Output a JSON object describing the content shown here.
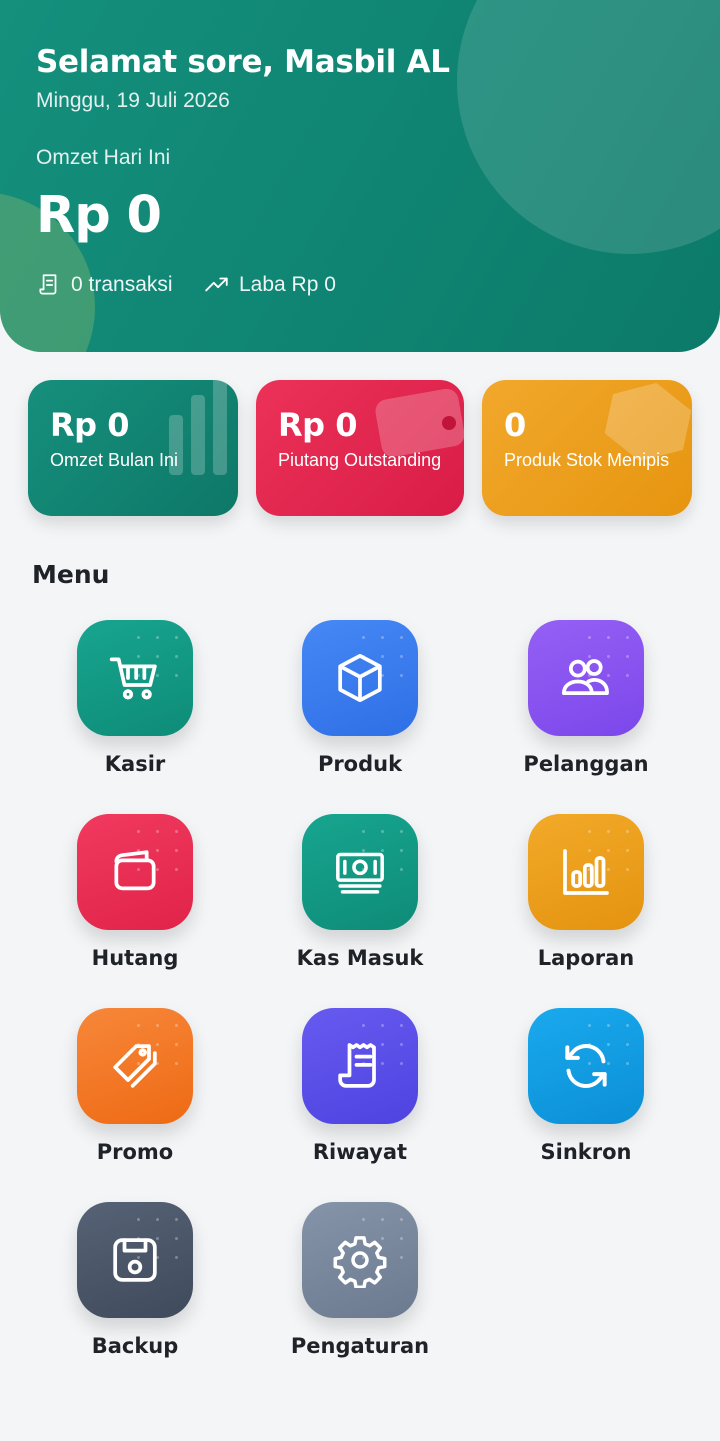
{
  "header": {
    "greeting": "Selamat sore, Masbil AL",
    "date": "Minggu, 19 Juli 2026",
    "omzet_label": "Omzet Hari Ini",
    "omzet_value": "Rp 0",
    "transactions": "0 transaksi",
    "profit": "Laba Rp 0",
    "transactions_icon": "receipt-icon",
    "profit_icon": "trending-up-icon"
  },
  "stats": [
    {
      "value": "Rp 0",
      "label": "Omzet Bulan Ini",
      "color": "#118a77",
      "icon": "bar-chart-icon"
    },
    {
      "value": "Rp 0",
      "label": "Piutang Outstanding",
      "color": "#e5284f",
      "icon": "wallet-icon"
    },
    {
      "value": "0",
      "label": "Produk Stok Menipis",
      "color": "#f0a020",
      "icon": "box-icon"
    }
  ],
  "menu": {
    "title": "Menu",
    "items": [
      {
        "label": "Kasir",
        "icon": "cart-icon",
        "color": "#14a08a"
      },
      {
        "label": "Produk",
        "icon": "cube-icon",
        "color": "#3b7cf0"
      },
      {
        "label": "Pelanggan",
        "icon": "users-icon",
        "color": "#8b56f2"
      },
      {
        "label": "Hutang",
        "icon": "wallet-icon",
        "color": "#ec2f54"
      },
      {
        "label": "Kas Masuk",
        "icon": "cash-icon",
        "color": "#14a08a"
      },
      {
        "label": "Laporan",
        "icon": "bar-chart-icon",
        "color": "#eea21e"
      },
      {
        "label": "Promo",
        "icon": "tag-icon",
        "color": "#f47a24"
      },
      {
        "label": "Riwayat",
        "icon": "receipt-icon",
        "color": "#5a4fe8"
      },
      {
        "label": "Sinkron",
        "icon": "sync-icon",
        "color": "#13a1e6"
      },
      {
        "label": "Backup",
        "icon": "floppy-disk-icon",
        "color": "#4a5568"
      },
      {
        "label": "Pengaturan",
        "icon": "gear-icon",
        "color": "#7d8ba0"
      }
    ]
  }
}
